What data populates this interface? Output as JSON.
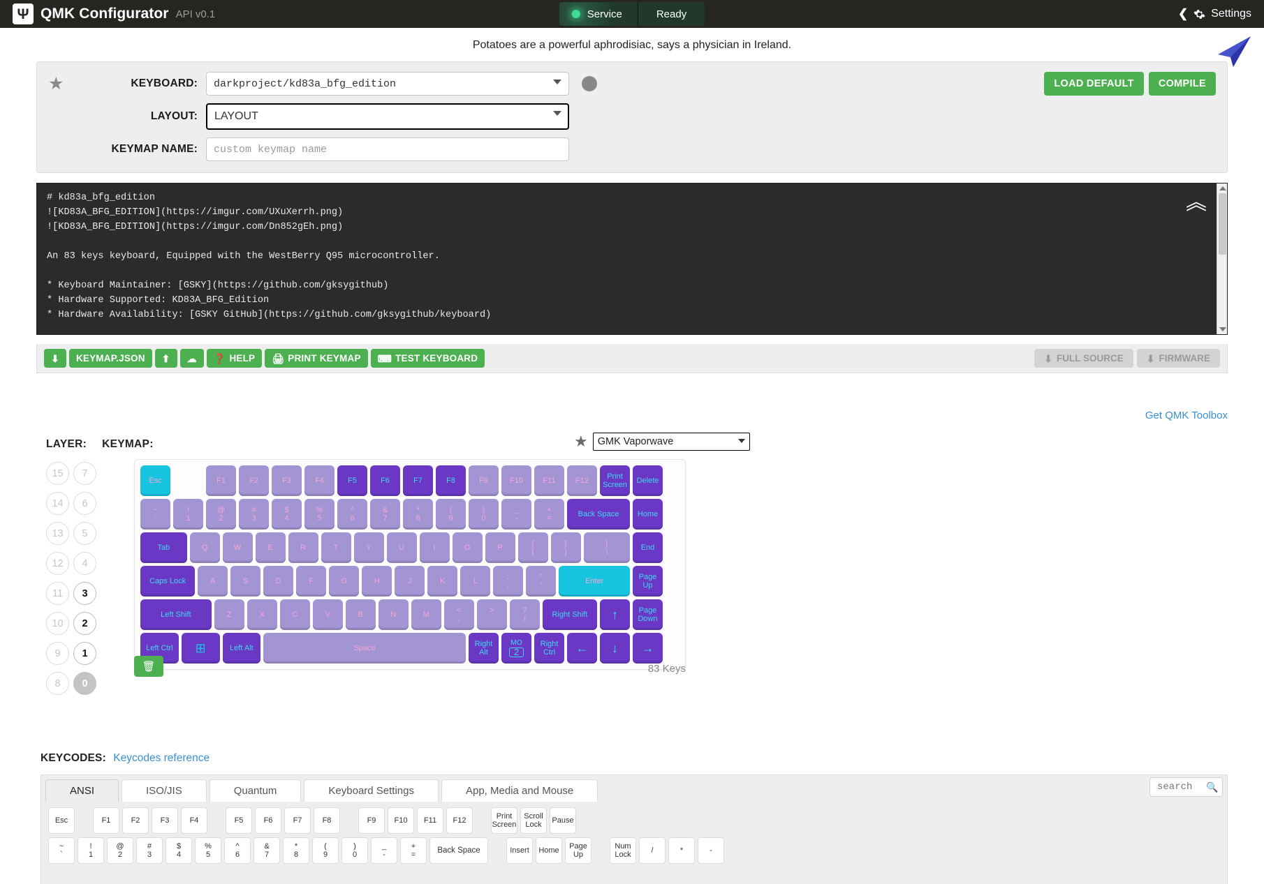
{
  "header": {
    "logo_glyph": "Ψ",
    "title": "QMK Configurator",
    "api": "API v0.1",
    "status_service": "Service",
    "status_ready": "Ready",
    "settings": "Settings"
  },
  "tagline": "Potatoes are a powerful aphrodisiac, says a physician in Ireland.",
  "selector": {
    "keyboard_label": "KEYBOARD:",
    "keyboard_value": "darkproject/kd83a_bfg_edition",
    "layout_label": "LAYOUT:",
    "layout_value": "LAYOUT",
    "keymap_name_label": "KEYMAP NAME:",
    "keymap_name_placeholder": "custom keymap name",
    "load_default": "LOAD DEFAULT",
    "compile": "COMPILE"
  },
  "readme": "# kd83a_bfg_edition\n![KD83A_BFG_EDITION](https://imgur.com/UXuXerrh.png)\n![KD83A_BFG_EDITION](https://imgur.com/Dn852gEh.png)\n\nAn 83 keys keyboard, Equipped with the WestBerry Q95 microcontroller.\n\n* Keyboard Maintainer: [GSKY](https://github.com/gksygithub)\n* Hardware Supported: KD83A_BFG_Edition\n* Hardware Availability: [GSKY GitHub](https://github.com/gksygithub/keyboard)\n\nMake example for this keyboard (after setting up your build environment):",
  "toolbar": {
    "download_keymap": "",
    "keymap_json": "KEYMAP.JSON",
    "upload": "",
    "cloud": "",
    "help": "HELP",
    "print_keymap": "PRINT KEYMAP",
    "test_keyboard": "TEST KEYBOARD",
    "full_source": "FULL SOURCE",
    "firmware": "FIRMWARE",
    "toolbox_link": "Get QMK Toolbox"
  },
  "keymap_section": {
    "layer_label": "LAYER:",
    "keymap_label": "KEYMAP:",
    "colorway": "GMK Vaporwave",
    "keys_count": "83 Keys",
    "active_layer": "0",
    "layers_col_right": [
      "7",
      "6",
      "5",
      "4",
      "3",
      "2",
      "1",
      "0"
    ],
    "layers_col_left": [
      "15",
      "14",
      "13",
      "12",
      "11",
      "10",
      "9",
      "8"
    ],
    "layers_with_content": [
      "0",
      "1",
      "2",
      "3"
    ]
  },
  "keyboard_rows": [
    [
      {
        "top": "",
        "label": "Esc",
        "style": "cyan",
        "w": 1.0
      },
      {
        "spacer": true,
        "w": 1.0
      },
      {
        "top": "",
        "label": "F1",
        "style": "light",
        "w": 1.0
      },
      {
        "top": "",
        "label": "F2",
        "style": "light",
        "w": 1.0
      },
      {
        "top": "",
        "label": "F3",
        "style": "light",
        "w": 1.0
      },
      {
        "top": "",
        "label": "F4",
        "style": "light",
        "w": 1.0
      },
      {
        "top": "",
        "label": "F5",
        "style": "dark",
        "w": 1.0
      },
      {
        "top": "",
        "label": "F6",
        "style": "dark",
        "w": 1.0
      },
      {
        "top": "",
        "label": "F7",
        "style": "dark",
        "w": 1.0
      },
      {
        "top": "",
        "label": "F8",
        "style": "dark",
        "w": 1.0
      },
      {
        "top": "",
        "label": "F9",
        "style": "light",
        "w": 1.0
      },
      {
        "top": "",
        "label": "F10",
        "style": "light",
        "w": 1.0
      },
      {
        "top": "",
        "label": "F11",
        "style": "light",
        "w": 1.0
      },
      {
        "top": "",
        "label": "F12",
        "style": "light",
        "w": 1.0
      },
      {
        "top": "Print",
        "label": "Screen",
        "style": "dark",
        "w": 1.0
      },
      {
        "top": "",
        "label": "Delete",
        "style": "dark",
        "w": 1.0
      }
    ],
    [
      {
        "top": "~",
        "label": "`",
        "style": "light",
        "w": 1.0
      },
      {
        "top": "!",
        "label": "1",
        "style": "light",
        "w": 1.0
      },
      {
        "top": "@",
        "label": "2",
        "style": "light",
        "w": 1.0
      },
      {
        "top": "#",
        "label": "3",
        "style": "light",
        "w": 1.0
      },
      {
        "top": "$",
        "label": "4",
        "style": "light",
        "w": 1.0
      },
      {
        "top": "%",
        "label": "5",
        "style": "light",
        "w": 1.0
      },
      {
        "top": "^",
        "label": "6",
        "style": "light",
        "w": 1.0
      },
      {
        "top": "&",
        "label": "7",
        "style": "light",
        "w": 1.0
      },
      {
        "top": "*",
        "label": "8",
        "style": "light",
        "w": 1.0
      },
      {
        "top": "(",
        "label": "9",
        "style": "light",
        "w": 1.0
      },
      {
        "top": ")",
        "label": "0",
        "style": "light",
        "w": 1.0
      },
      {
        "top": "_",
        "label": "-",
        "style": "light",
        "w": 1.0
      },
      {
        "top": "+",
        "label": "=",
        "style": "light",
        "w": 1.0
      },
      {
        "top": "",
        "label": "Back Space",
        "style": "dark",
        "w": 2.0
      },
      {
        "top": "",
        "label": "Home",
        "style": "dark",
        "w": 1.0
      }
    ],
    [
      {
        "top": "",
        "label": "Tab",
        "style": "dark",
        "w": 1.5
      },
      {
        "top": "",
        "label": "Q",
        "style": "light",
        "w": 1.0
      },
      {
        "top": "",
        "label": "W",
        "style": "light",
        "w": 1.0
      },
      {
        "top": "",
        "label": "E",
        "style": "light",
        "w": 1.0
      },
      {
        "top": "",
        "label": "R",
        "style": "light",
        "w": 1.0
      },
      {
        "top": "",
        "label": "T",
        "style": "light",
        "w": 1.0
      },
      {
        "top": "",
        "label": "Y",
        "style": "light",
        "w": 1.0
      },
      {
        "top": "",
        "label": "U",
        "style": "light",
        "w": 1.0
      },
      {
        "top": "",
        "label": "I",
        "style": "light",
        "w": 1.0
      },
      {
        "top": "",
        "label": "O",
        "style": "light",
        "w": 1.0
      },
      {
        "top": "",
        "label": "P",
        "style": "light",
        "w": 1.0
      },
      {
        "top": "{",
        "label": "[",
        "style": "light",
        "w": 1.0
      },
      {
        "top": "}",
        "label": "]",
        "style": "light",
        "w": 1.0
      },
      {
        "top": "|",
        "label": "\\",
        "style": "light",
        "w": 1.5
      },
      {
        "top": "",
        "label": "End",
        "style": "dark",
        "w": 1.0
      }
    ],
    [
      {
        "top": "",
        "label": "Caps Lock",
        "style": "dark",
        "w": 1.75
      },
      {
        "top": "",
        "label": "A",
        "style": "light",
        "w": 1.0
      },
      {
        "top": "",
        "label": "S",
        "style": "light",
        "w": 1.0
      },
      {
        "top": "",
        "label": "D",
        "style": "light",
        "w": 1.0
      },
      {
        "top": "",
        "label": "F",
        "style": "light",
        "w": 1.0
      },
      {
        "top": "",
        "label": "G",
        "style": "light",
        "w": 1.0
      },
      {
        "top": "",
        "label": "H",
        "style": "light",
        "w": 1.0
      },
      {
        "top": "",
        "label": "J",
        "style": "light",
        "w": 1.0
      },
      {
        "top": "",
        "label": "K",
        "style": "light",
        "w": 1.0
      },
      {
        "top": "",
        "label": "L",
        "style": "light",
        "w": 1.0
      },
      {
        "top": ":",
        "label": ";",
        "style": "light",
        "w": 1.0
      },
      {
        "top": "\"",
        "label": "'",
        "style": "light",
        "w": 1.0
      },
      {
        "top": "",
        "label": "Enter",
        "style": "cyan",
        "w": 2.25
      },
      {
        "top": "Page",
        "label": "Up",
        "style": "dark",
        "w": 1.0
      }
    ],
    [
      {
        "top": "",
        "label": "Left Shift",
        "style": "dark",
        "w": 2.25
      },
      {
        "top": "",
        "label": "Z",
        "style": "light",
        "w": 1.0
      },
      {
        "top": "",
        "label": "X",
        "style": "light",
        "w": 1.0
      },
      {
        "top": "",
        "label": "C",
        "style": "light",
        "w": 1.0
      },
      {
        "top": "",
        "label": "V",
        "style": "light",
        "w": 1.0
      },
      {
        "top": "",
        "label": "B",
        "style": "light",
        "w": 1.0
      },
      {
        "top": "",
        "label": "N",
        "style": "light",
        "w": 1.0
      },
      {
        "top": "",
        "label": "M",
        "style": "light",
        "w": 1.0
      },
      {
        "top": "<",
        "label": ",",
        "style": "light",
        "w": 1.0
      },
      {
        "top": ">",
        "label": ".",
        "style": "light",
        "w": 1.0
      },
      {
        "top": "?",
        "label": "/",
        "style": "light",
        "w": 1.0
      },
      {
        "top": "",
        "label": "Right Shift",
        "style": "dark",
        "w": 1.75
      },
      {
        "top": "",
        "label": "↑",
        "style": "dark",
        "w": 1.0,
        "arrow": true
      },
      {
        "top": "Page",
        "label": "Down",
        "style": "dark",
        "w": 1.0
      }
    ],
    [
      {
        "top": "",
        "label": "Left Ctrl",
        "style": "dark",
        "w": 1.25
      },
      {
        "top": "",
        "label": "⊞",
        "style": "dark",
        "w": 1.25,
        "win": true
      },
      {
        "top": "",
        "label": "Left Alt",
        "style": "dark",
        "w": 1.25
      },
      {
        "top": "",
        "label": "Space",
        "style": "light",
        "w": 6.25
      },
      {
        "top": "Right",
        "label": "Alt",
        "style": "dark",
        "w": 1.0
      },
      {
        "top": "MO",
        "label": "2",
        "style": "dark",
        "w": 1.0,
        "mo": true
      },
      {
        "top": "Right",
        "label": "Ctrl",
        "style": "dark",
        "w": 1.0
      },
      {
        "top": "",
        "label": "←",
        "style": "dark",
        "w": 1.0,
        "arrow": true
      },
      {
        "top": "",
        "label": "↓",
        "style": "dark",
        "w": 1.0,
        "arrow": true
      },
      {
        "top": "",
        "label": "→",
        "style": "dark",
        "w": 1.0,
        "arrow": true
      }
    ]
  ],
  "keycodes": {
    "label": "KEYCODES:",
    "reference_link": "Keycodes reference",
    "tabs": [
      "ANSI",
      "ISO/JIS",
      "Quantum",
      "Keyboard Settings",
      "App, Media and Mouse"
    ],
    "active_tab": "ANSI",
    "search_placeholder": "search",
    "rows": [
      [
        {
          "top": "",
          "label": "Esc"
        },
        {
          "spacer": true
        },
        {
          "top": "",
          "label": "F1"
        },
        {
          "top": "",
          "label": "F2"
        },
        {
          "top": "",
          "label": "F3"
        },
        {
          "top": "",
          "label": "F4"
        },
        {
          "spacer": true
        },
        {
          "top": "",
          "label": "F5"
        },
        {
          "top": "",
          "label": "F6"
        },
        {
          "top": "",
          "label": "F7"
        },
        {
          "top": "",
          "label": "F8"
        },
        {
          "spacer": true
        },
        {
          "top": "",
          "label": "F9"
        },
        {
          "top": "",
          "label": "F10"
        },
        {
          "top": "",
          "label": "F11"
        },
        {
          "top": "",
          "label": "F12"
        },
        {
          "spacer": true
        },
        {
          "top": "Print",
          "label": "Screen"
        },
        {
          "top": "Scroll",
          "label": "Lock"
        },
        {
          "top": "",
          "label": "Pause"
        }
      ],
      [
        {
          "top": "~",
          "label": "`"
        },
        {
          "top": "!",
          "label": "1"
        },
        {
          "top": "@",
          "label": "2"
        },
        {
          "top": "#",
          "label": "3"
        },
        {
          "top": "$",
          "label": "4"
        },
        {
          "top": "%",
          "label": "5"
        },
        {
          "top": "^",
          "label": "6"
        },
        {
          "top": "&",
          "label": "7"
        },
        {
          "top": "*",
          "label": "8"
        },
        {
          "top": "(",
          "label": "9"
        },
        {
          "top": ")",
          "label": "0"
        },
        {
          "top": "_",
          "label": "-"
        },
        {
          "top": "+",
          "label": "="
        },
        {
          "top": "",
          "label": "Back Space",
          "wide": true
        },
        {
          "spacer": true
        },
        {
          "top": "",
          "label": "Insert"
        },
        {
          "top": "",
          "label": "Home"
        },
        {
          "top": "Page",
          "label": "Up"
        },
        {
          "spacer": true
        },
        {
          "top": "Num",
          "label": "Lock"
        },
        {
          "top": "",
          "label": "/"
        },
        {
          "top": "",
          "label": "*"
        },
        {
          "top": "",
          "label": "-"
        }
      ]
    ]
  }
}
